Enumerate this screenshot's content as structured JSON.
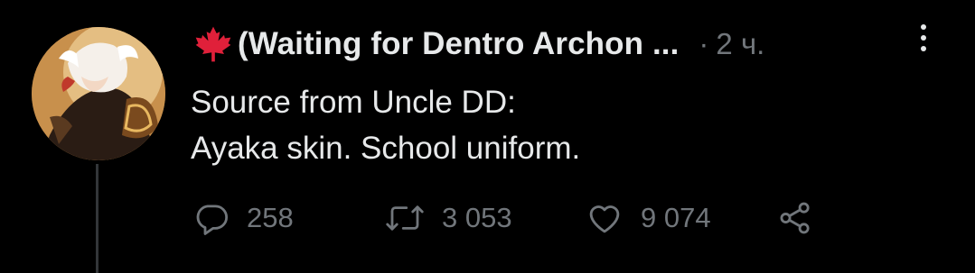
{
  "tweet": {
    "display_name": "(Waiting for Dentro Archon ...",
    "separator": "·",
    "time": "2 ч.",
    "text_lines": [
      "Source from Uncle DD:",
      "Ayaka skin. School uniform."
    ]
  },
  "actions": {
    "reply_count": "258",
    "retweet_count": "3 053",
    "like_count": "9 074"
  },
  "icons": {
    "flag": "maple-leaf-icon",
    "more": "more-options-icon",
    "reply": "reply-icon",
    "retweet": "retweet-icon",
    "like": "heart-icon",
    "share": "share-icon"
  },
  "colors": {
    "background": "#000000",
    "primary_text": "#e7e9ea",
    "secondary_text": "#71767b",
    "maple_leaf": "#e0203a",
    "thread_line": "#333639"
  }
}
